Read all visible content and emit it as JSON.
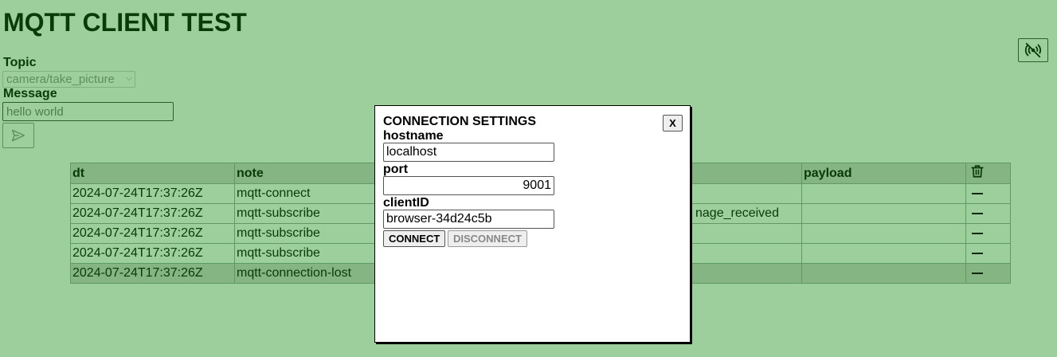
{
  "page": {
    "title": "MQTT CLIENT TEST"
  },
  "publish": {
    "topic_label": "Topic",
    "topic_selected": "camera/take_picture",
    "message_label": "Message",
    "message_placeholder": "hello world"
  },
  "icons": {
    "connection": "broadcast-off-icon",
    "send": "send-icon",
    "trash": "trash-icon",
    "remove": "minus-icon"
  },
  "log": {
    "columns": [
      "dt",
      "note",
      "",
      "payload"
    ],
    "rows": [
      {
        "dt": "2024-07-24T17:37:26Z",
        "note": "mqtt-connect",
        "topic": "",
        "payload": ""
      },
      {
        "dt": "2024-07-24T17:37:26Z",
        "note": "mqtt-subscribe",
        "topic": "nage_received",
        "payload": ""
      },
      {
        "dt": "2024-07-24T17:37:26Z",
        "note": "mqtt-subscribe",
        "topic": "",
        "payload": ""
      },
      {
        "dt": "2024-07-24T17:37:26Z",
        "note": "mqtt-subscribe",
        "topic": "",
        "payload": ""
      },
      {
        "dt": "2024-07-24T17:37:26Z",
        "note": "mqtt-connection-lost",
        "topic": "",
        "payload": ""
      }
    ]
  },
  "settings": {
    "title": "CONNECTION SETTINGS",
    "close_label": "X",
    "hostname_label": "hostname",
    "hostname_value": "localhost",
    "port_label": "port",
    "port_value": "9001",
    "clientid_label": "clientID",
    "clientid_value": "browser-34d24c5b",
    "connect_label": "CONNECT",
    "disconnect_label": "DISCONNECT"
  },
  "colors": {
    "background": "#9ccf9b",
    "text": "#083b08",
    "header_row": "#84b583",
    "modal_bg": "#ffffff"
  }
}
